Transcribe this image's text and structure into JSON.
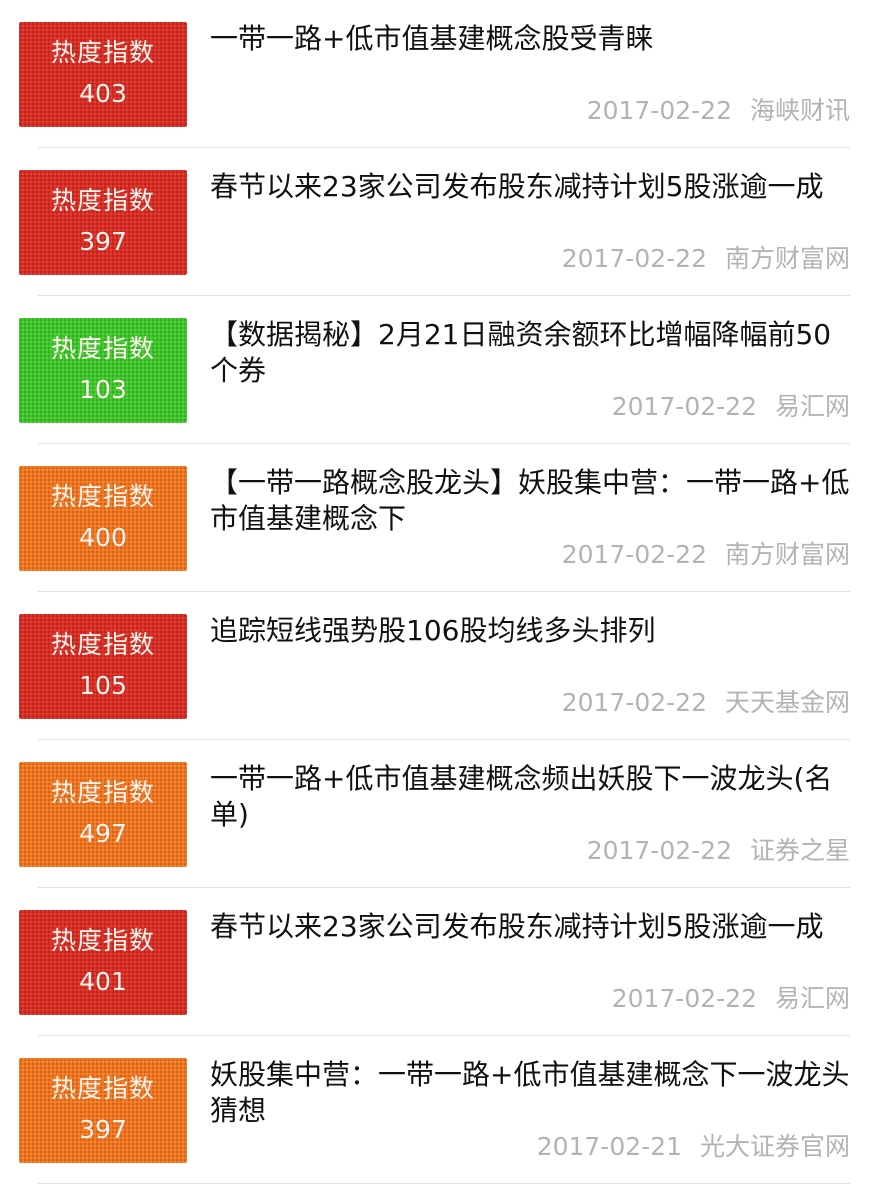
{
  "badge_label": "热度指数",
  "colors": {
    "hot_red": "#db2c22",
    "cold_green": "#3ec929",
    "warm_orange": "#f3761e",
    "title_text": "#111111",
    "meta_text": "#b3b3b3",
    "divider": "#e2e2e2"
  },
  "items": [
    {
      "score": "403",
      "color": "red",
      "title": "一带一路+低市值基建概念股受青睐",
      "date": "2017-02-22",
      "source": "海峡财讯"
    },
    {
      "score": "397",
      "color": "red",
      "title": "春节以来23家公司发布股东减持计划5股涨逾一成",
      "date": "2017-02-22",
      "source": "南方财富网"
    },
    {
      "score": "103",
      "color": "green",
      "title": "【数据揭秘】2月21日融资余额环比增幅降幅前50个券",
      "date": "2017-02-22",
      "source": "易汇网"
    },
    {
      "score": "400",
      "color": "orange",
      "title": "【一带一路概念股龙头】妖股集中营：一带一路+低市值基建概念下",
      "date": "2017-02-22",
      "source": "南方财富网"
    },
    {
      "score": "105",
      "color": "red",
      "title": "追踪短线强势股106股均线多头排列",
      "date": "2017-02-22",
      "source": "天天基金网"
    },
    {
      "score": "497",
      "color": "orange",
      "title": "一带一路+低市值基建概念频出妖股下一波龙头(名单)",
      "date": "2017-02-22",
      "source": "证券之星"
    },
    {
      "score": "401",
      "color": "red",
      "title": "春节以来23家公司发布股东减持计划5股涨逾一成",
      "date": "2017-02-22",
      "source": "易汇网"
    },
    {
      "score": "397",
      "color": "orange",
      "title": "妖股集中营：一带一路+低市值基建概念下一波龙头猜想",
      "date": "2017-02-21",
      "source": "光大证券官网"
    }
  ]
}
